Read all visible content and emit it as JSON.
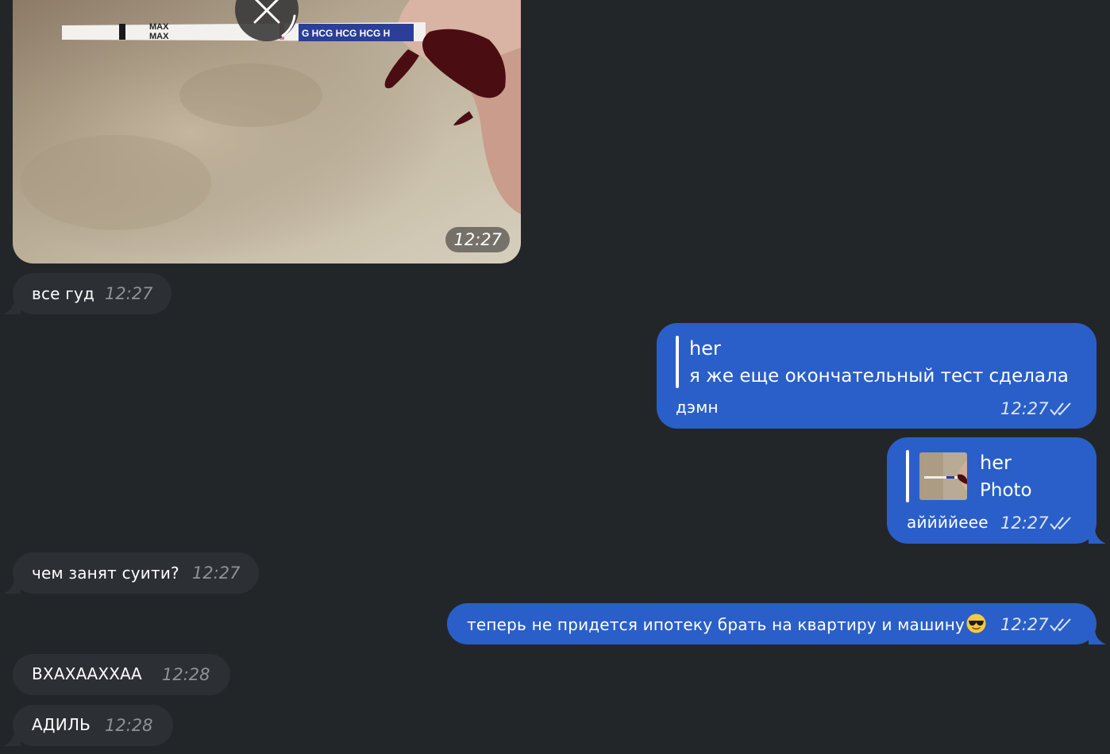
{
  "chat": {
    "photo_message": {
      "time": "12:27"
    },
    "messages": [
      {
        "text": "все гуд",
        "time": "12:27"
      },
      {
        "quote_name": "her",
        "quote_text": "я же еще окончательный тест сделала",
        "text": "дэмн",
        "time": "12:27"
      },
      {
        "quote_name": "her",
        "quote_text": "Photo",
        "text": "аййййеее",
        "time": "12:27"
      },
      {
        "text": "чем занят суити?",
        "time": "12:27"
      },
      {
        "text": "теперь не придется ипотеку брать на квартиру и машину",
        "emoji": "smiling-face-with-sunglasses",
        "time": "12:27"
      },
      {
        "text": "ВХАХААХХАА",
        "time": "12:28"
      },
      {
        "text": "АДИЛЬ",
        "time": "12:28"
      }
    ]
  },
  "photo_strip_labels": {
    "max1": "MAX",
    "max2": "MAX",
    "hcg": "G HCG HCG HCG H"
  },
  "colors": {
    "background": "#232629",
    "incoming_bubble": "#2c2f33",
    "outgoing_bubble": "#2a5fc9"
  }
}
